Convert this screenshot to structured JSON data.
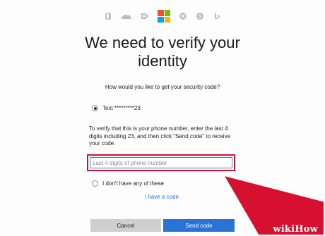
{
  "header": {
    "icons": [
      {
        "name": "office-icon",
        "color": "#b8b8b8"
      },
      {
        "name": "onedrive-icon",
        "color": "#b8b8b8"
      },
      {
        "name": "outlook-icon",
        "color": "#b8b8b8"
      },
      {
        "name": "microsoft-logo-icon",
        "colors": [
          "#f25022",
          "#7fba00",
          "#00a4ef",
          "#ffb900"
        ]
      },
      {
        "name": "xbox-icon",
        "color": "#b8b8b8"
      },
      {
        "name": "skype-icon",
        "color": "#b8b8b8"
      },
      {
        "name": "bing-icon",
        "color": "#b8b8b8"
      }
    ]
  },
  "title_line1": "We need to verify your",
  "title_line2": "identity",
  "question": "How would you like to get your security code?",
  "option_text": "Text *********23",
  "instructions": "To verify that this is your phone number, enter the last 4 digits including 23, and then click \"Send code\" to receive your code.",
  "phone_input": {
    "placeholder": "Last 4 digits of phone number",
    "value": ""
  },
  "option_none": "I don't have any of these",
  "have_code_link": "I have a code",
  "cancel_label": "Cancel",
  "send_label": "Send code",
  "accent_color": "#2a73d6",
  "highlight_color": "#d0102a",
  "watermark": "wikiHow"
}
